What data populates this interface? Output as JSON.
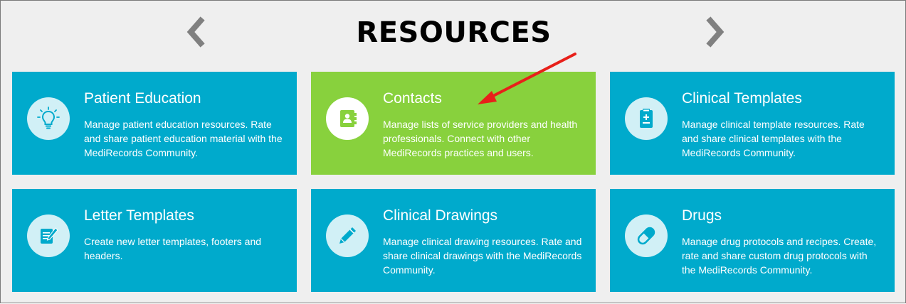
{
  "header": {
    "title": "RESOURCES",
    "prev_icon": "chevron-left-icon",
    "next_icon": "chevron-right-icon"
  },
  "colors": {
    "card": "#00aacc",
    "card_active": "#88d13d",
    "arrow_nav": "#808080",
    "annotation": "#e8201a"
  },
  "cards": [
    {
      "title": "Patient Education",
      "description": "Manage patient education resources. Rate and share patient education material with the MediRecords Community.",
      "icon": "lightbulb-icon"
    },
    {
      "title": "Contacts",
      "description": "Manage lists of service providers and health professionals. Connect with other MediRecords practices and users.",
      "icon": "address-book-icon",
      "active": true
    },
    {
      "title": "Clinical Templates",
      "description": "Manage clinical template resources. Rate and share clinical templates with the MediRecords Community.",
      "icon": "clipboard-icon"
    },
    {
      "title": "Letter Templates",
      "description": "Create new letter templates, footers and headers.",
      "icon": "document-edit-icon"
    },
    {
      "title": "Clinical Drawings",
      "description": "Manage clinical drawing resources. Rate and share clinical drawings with the MediRecords Community.",
      "icon": "pencil-icon"
    },
    {
      "title": "Drugs",
      "description": "Manage drug protocols and recipes. Create, rate and share custom drug protocols with the MediRecords Community.",
      "icon": "pill-icon"
    }
  ]
}
